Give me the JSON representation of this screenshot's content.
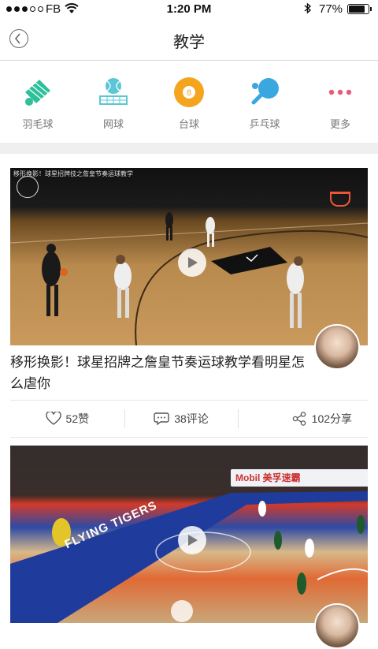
{
  "status_bar": {
    "carrier": "FB",
    "time": "1:20 PM",
    "battery": "77%",
    "battery_level": 0.77
  },
  "header": {
    "title": "教学"
  },
  "categories": [
    {
      "label": "羽毛球",
      "icon": "badminton-icon",
      "color": "#2ec09a"
    },
    {
      "label": "网球",
      "icon": "tennis-icon",
      "color": "#5bc7d6"
    },
    {
      "label": "台球",
      "icon": "billiards-icon",
      "color": "#f5a41e"
    },
    {
      "label": "乒乓球",
      "icon": "ping-pong-icon",
      "color": "#3aa7e0"
    },
    {
      "label": "更多",
      "icon": "more-icon",
      "color": "#e85a7a"
    }
  ],
  "videos": [
    {
      "overlay_caption": "移形换影！球星招牌技之詹皇节奏运球教学",
      "title": "移形换影！球星招牌之詹皇节奏运球教学看明星怎么虐你",
      "likes": "52赞",
      "comments": "38评论",
      "shares": "102分享"
    },
    {
      "banner_text": "Mobil 美孚速霸",
      "court_text": "FLYING TIGERS"
    }
  ]
}
